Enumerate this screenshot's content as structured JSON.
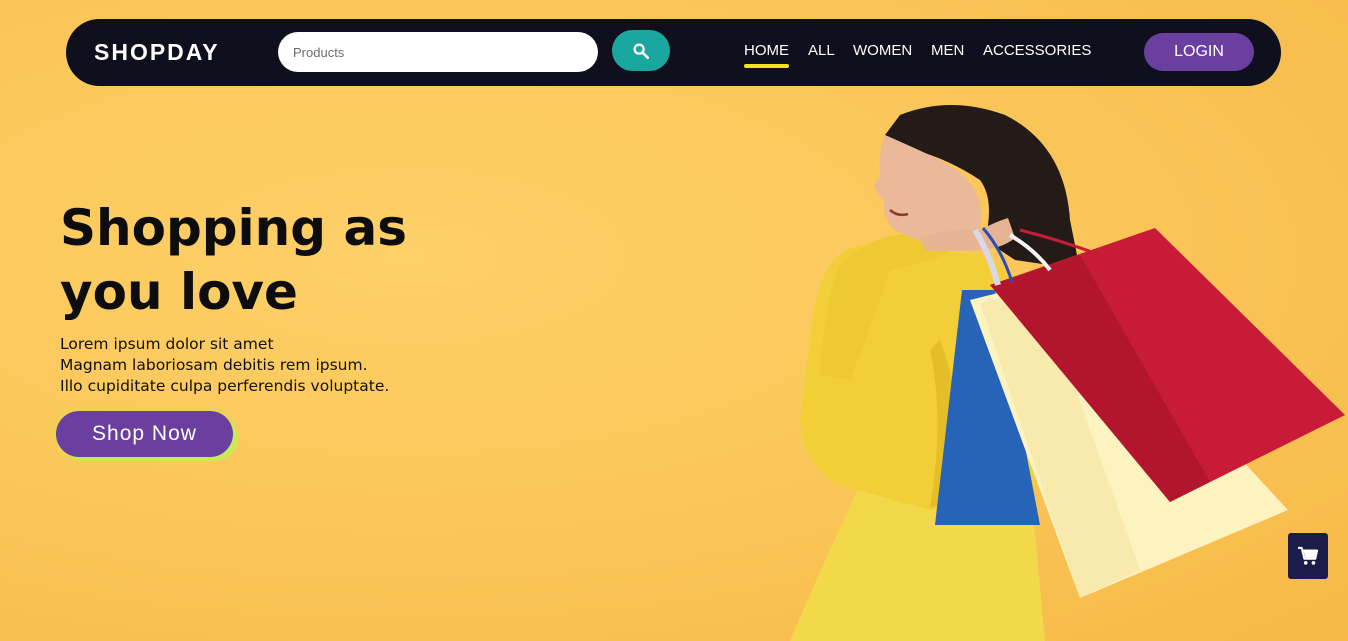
{
  "header": {
    "brand": "SHOPDAY",
    "search": {
      "placeholder": "Products",
      "value": "",
      "button_icon": "search-icon"
    },
    "nav": [
      {
        "label": "HOME",
        "active": true
      },
      {
        "label": "ALL",
        "active": false
      },
      {
        "label": "WOMEN",
        "active": false
      },
      {
        "label": "MEN",
        "active": false
      },
      {
        "label": "ACCESSORIES",
        "active": false
      }
    ],
    "login_label": "LOGIN"
  },
  "hero": {
    "title_line1": "Shopping as",
    "title_line2": "you love",
    "description": [
      "Lorem ipsum dolor sit amet",
      "Magnam laboriosam debitis rem ipsum.",
      "Illo cupiditate culpa perferendis voluptate."
    ],
    "cta_label": "Shop Now",
    "image_subject": "woman-with-shopping-bags"
  },
  "cart": {
    "icon": "cart-icon"
  },
  "colors": {
    "background": "#fbc75a",
    "navbar": "#0f0f1e",
    "accent_purple": "#6b3fa0",
    "search_button": "#1aa7a0",
    "active_underline": "#f5e020",
    "cta_glow": "#c9ea55",
    "cart_button": "#1c1c4a"
  }
}
